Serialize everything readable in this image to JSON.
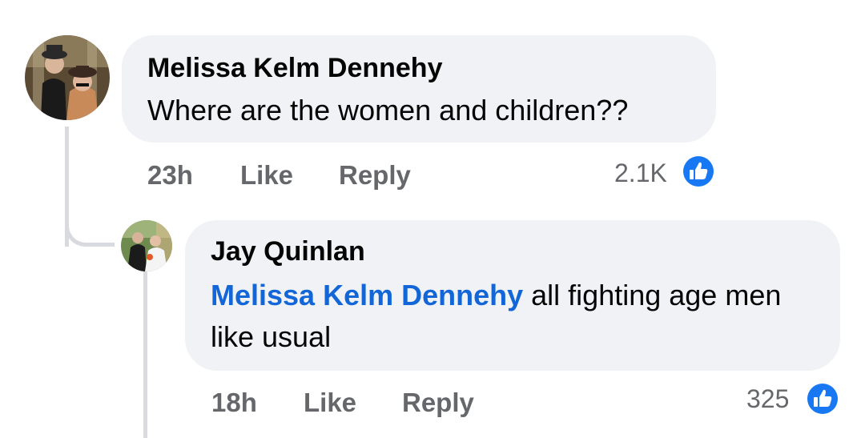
{
  "comments": [
    {
      "author": "Melissa Kelm Dennehy",
      "text": "Where are the women and children??",
      "time": "23h",
      "like_label": "Like",
      "reply_label": "Reply",
      "reaction_count": "2.1K",
      "reaction_icon": "thumbs-up-icon"
    },
    {
      "author": "Jay Quinlan",
      "mention": "Melissa Kelm Dennehy",
      "text": " all fighting age men like usual",
      "time": "18h",
      "like_label": "Like",
      "reply_label": "Reply",
      "reaction_count": "325",
      "reaction_icon": "thumbs-up-icon"
    }
  ],
  "colors": {
    "bubble": "#f0f2f5",
    "mention": "#1266d8",
    "meta": "#65676b",
    "like_badge": "#1877f2",
    "thread_line": "#d9dadf"
  }
}
